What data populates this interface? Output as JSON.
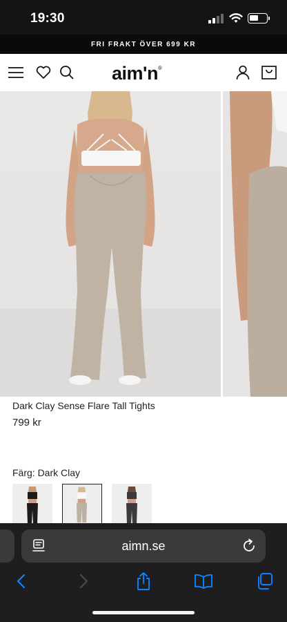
{
  "status_bar": {
    "time": "19:30"
  },
  "promo_banner": {
    "text": "FRI FRAKT ÖVER 699 KR"
  },
  "header": {
    "logo_text": "aim'n",
    "logo_mark": "®",
    "icons": [
      "menu-icon",
      "heart-icon",
      "search-icon",
      "account-icon",
      "cart-icon"
    ]
  },
  "product": {
    "name": "Dark Clay Sense Flare Tall Tights",
    "price": "799 kr",
    "color_label": "Färg: Dark Clay",
    "swatches": [
      {
        "color_name": "black",
        "hex": "#1c1c1c",
        "selected": false
      },
      {
        "color_name": "dark clay",
        "hex": "#bdb1a2",
        "selected": true
      },
      {
        "color_name": "charcoal",
        "hex": "#3b3b3d",
        "selected": false
      }
    ]
  },
  "browser": {
    "url": "aimn.se",
    "toolbar": [
      "back-icon",
      "forward-icon",
      "share-icon",
      "bookmarks-icon",
      "tabs-icon"
    ],
    "accent": "#0a84ff"
  }
}
